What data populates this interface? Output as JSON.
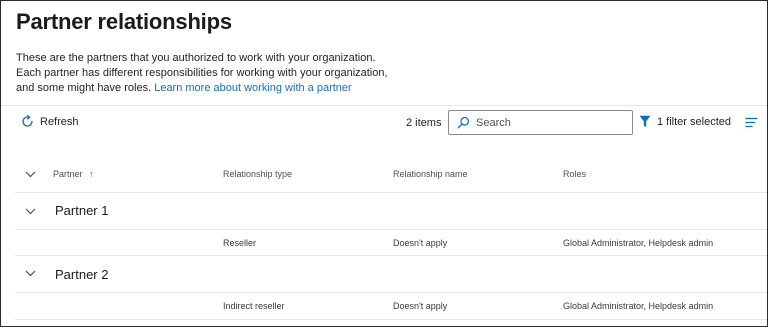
{
  "page": {
    "title": "Partner relationships",
    "description_line1": "These are the partners that you authorized to work with your organization.",
    "description_line2": "Each partner has different responsibilities for working with your organization,",
    "description_line3": "and some might have roles.",
    "learn_more_link": "Learn more about working with a partner"
  },
  "toolbar": {
    "refresh_label": "Refresh",
    "item_count": "2 items",
    "search_placeholder": "Search",
    "filter_label": "1 filter selected"
  },
  "table": {
    "columns": {
      "partner": "Partner",
      "partner_sort": "↑",
      "relationship_type": "Relationship type",
      "relationship_name": "Relationship name",
      "roles": "Roles"
    },
    "groups": [
      {
        "name": "Partner 1",
        "rows": [
          {
            "relationship_type": "Reseller",
            "relationship_name": "Doesn't apply",
            "roles": "Global Administrator, Helpdesk admin"
          }
        ]
      },
      {
        "name": "Partner 2",
        "rows": [
          {
            "relationship_type": "Indirect reseller",
            "relationship_name": "Doesn't apply",
            "roles": "Global Administrator, Helpdesk admin"
          }
        ]
      }
    ]
  },
  "colors": {
    "accent": "#0f6cbd",
    "link": "#1a6fb8",
    "divider": "#e6e6e6"
  },
  "icons": {
    "refresh": "refresh-icon",
    "search": "search-icon",
    "filter": "filter-icon",
    "menu": "menu-icon",
    "collapse": "chevron-down-icon"
  }
}
